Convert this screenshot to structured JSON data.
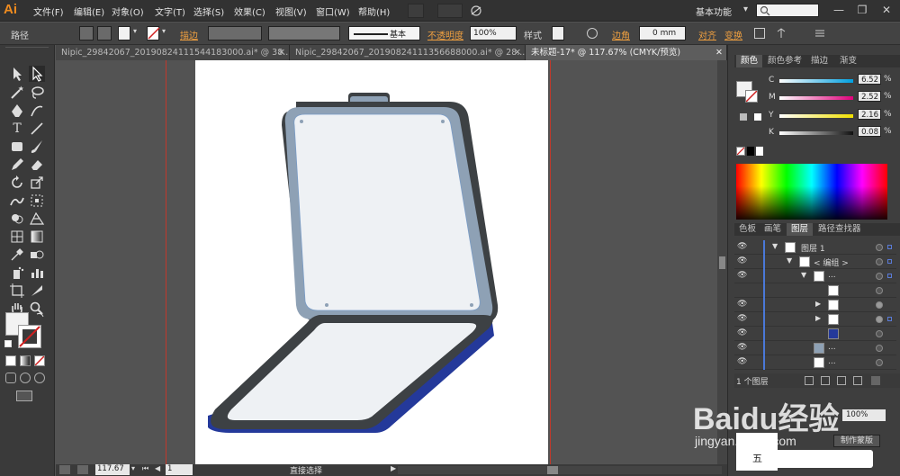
{
  "app": {
    "logo": "Ai"
  },
  "menu": [
    "文件(F)",
    "编辑(E)",
    "对象(O)",
    "文字(T)",
    "选择(S)",
    "效果(C)",
    "视图(V)",
    "窗口(W)",
    "帮助(H)"
  ],
  "workspace": {
    "label": "基本功能",
    "chevron": "▾"
  },
  "window_controls": {
    "minimize": "—",
    "restore": "❐",
    "close": "✕"
  },
  "control_bar": {
    "selection_label": "路径",
    "stroke_label": "描边",
    "stroke_style": "基本",
    "opacity_label": "不透明度",
    "opacity_value": "100%",
    "style_label": "样式",
    "corner_label": "边角",
    "corner_value": "0 mm",
    "align_label": "对齐",
    "transform_label": "变换"
  },
  "tabs": [
    {
      "label": "Nipic_29842067_20190824111544183000.ai* @ 38...",
      "close": "✕"
    },
    {
      "label": "Nipic_29842067_20190824111356688000.ai* @ 28...",
      "close": "✕"
    },
    {
      "label": "未标题-17* @ 117.67% (CMYK/预览)",
      "close": "✕"
    }
  ],
  "color_panel": {
    "tabs": [
      "颜色",
      "颜色参考",
      "描边",
      "渐变"
    ],
    "channels": [
      {
        "name": "C",
        "value": "6.52",
        "unit": "%"
      },
      {
        "name": "M",
        "value": "2.52",
        "unit": "%"
      },
      {
        "name": "Y",
        "value": "2.16",
        "unit": "%"
      },
      {
        "name": "K",
        "value": "0.08",
        "unit": "%"
      }
    ]
  },
  "layers_panel": {
    "tabs": [
      "色板",
      "画笔",
      "图层",
      "路径查找器"
    ],
    "rows": [
      {
        "name": "图层 1",
        "expand": "▼"
      },
      {
        "name": "< 编组 >",
        "expand": "▼"
      },
      {
        "name": "...",
        "expand": "▼"
      },
      {
        "name": "",
        "expand": ""
      },
      {
        "name": "",
        "expand": "▶"
      },
      {
        "name": "",
        "expand": "▶"
      },
      {
        "name": "...",
        "expand": ""
      },
      {
        "name": "...",
        "expand": ""
      }
    ],
    "footer": "1 个图层"
  },
  "lower_panel": {
    "opacity_value": "100%",
    "mask_button": "制作蒙版"
  },
  "status": {
    "zoom": "117.67",
    "page": "1",
    "tool_label": "直接选择"
  },
  "watermark": {
    "brand": "Baidu经验",
    "url": "jingyan.baidu.com"
  },
  "colors": {
    "lid_outer": "#3d4144",
    "lid_frame": "#8ea1b5",
    "screen": "#eef1f4",
    "base_side": "#24399a",
    "guide": "#c0392b"
  },
  "icons": {
    "watermark_ime_bar": "五"
  }
}
